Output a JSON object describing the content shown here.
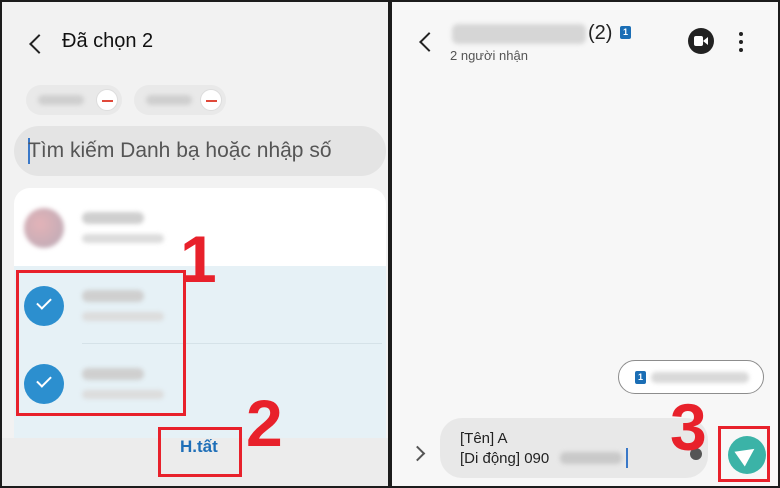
{
  "left": {
    "title": "Đã chọn 2",
    "search_placeholder": "Tìm kiếm Danh bạ hoặc nhập số",
    "select_all_label": "H.tất"
  },
  "right": {
    "recipient_count": "(2)",
    "recipients_label": "2 người nhận",
    "sim_badge": "1",
    "compose_line1": "[Tên] A",
    "compose_line2": "[Di động] 090"
  },
  "steps": [
    "1",
    "2",
    "3"
  ],
  "colors": {
    "accent_blue": "#2c8fcf",
    "link_blue": "#1f6fb8",
    "annotation_red": "#e8212b",
    "send_teal": "#3bb3a7",
    "selected_row": "#e6f1f6"
  },
  "icons": [
    "back-chevron-icon",
    "remove-icon",
    "check-icon",
    "video-call-icon",
    "more-options-icon",
    "sim-icon",
    "expand-icon",
    "attach-icon",
    "send-icon"
  ]
}
